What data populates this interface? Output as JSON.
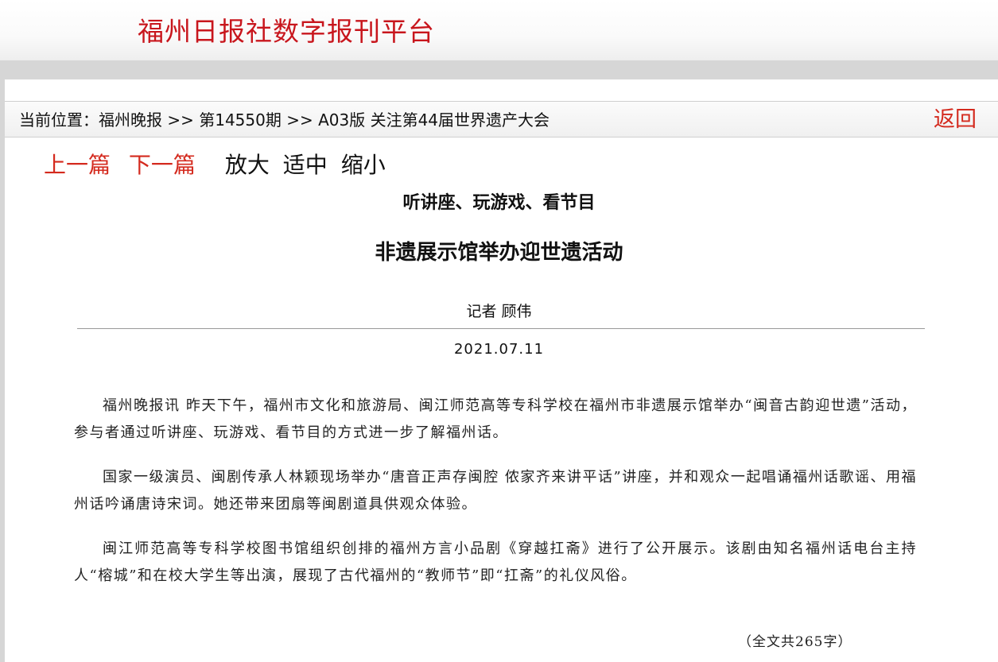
{
  "site": {
    "title": "福州日报社数字报刊平台"
  },
  "breadcrumb": {
    "prefix": "当前位置：",
    "newspaper": "福州晚报",
    "sep1": " >> ",
    "issue": "第14550期",
    "sep2": " >> ",
    "section": "A03版 关注第44届世界遗产大会"
  },
  "back_label": "返回",
  "toolbar": {
    "prev_label": "上一篇",
    "next_label": "下一篇",
    "zoom_in_label": "放大",
    "zoom_mid_label": "适中",
    "zoom_out_label": "缩小"
  },
  "article": {
    "subtitle": "听讲座、玩游戏、看节目",
    "headline": "非遗展示馆举办迎世遗活动",
    "author": "记者 顾伟",
    "date": "2021.07.11",
    "paragraphs": [
      "福州晚报讯 昨天下午，福州市文化和旅游局、闽江师范高等专科学校在福州市非遗展示馆举办“闽音古韵迎世遗”活动，参与者通过听讲座、玩游戏、看节目的方式进一步了解福州话。",
      "国家一级演员、闽剧传承人林颖现场举办“唐音正声存闽腔 侬家齐来讲平话”讲座，并和观众一起唱诵福州话歌谣、用福州话吟诵唐诗宋词。她还带来团扇等闽剧道具供观众体验。",
      "闽江师范高等专科学校图书馆组织创排的福州方言小品剧《穿越扛斋》进行了公开展示。该剧由知名福州话电台主持人“榕城”和在校大学生等出演，展现了古代福州的“教师节”即“扛斋”的礼仪风俗。"
    ],
    "word_count": "（全文共265字）"
  }
}
